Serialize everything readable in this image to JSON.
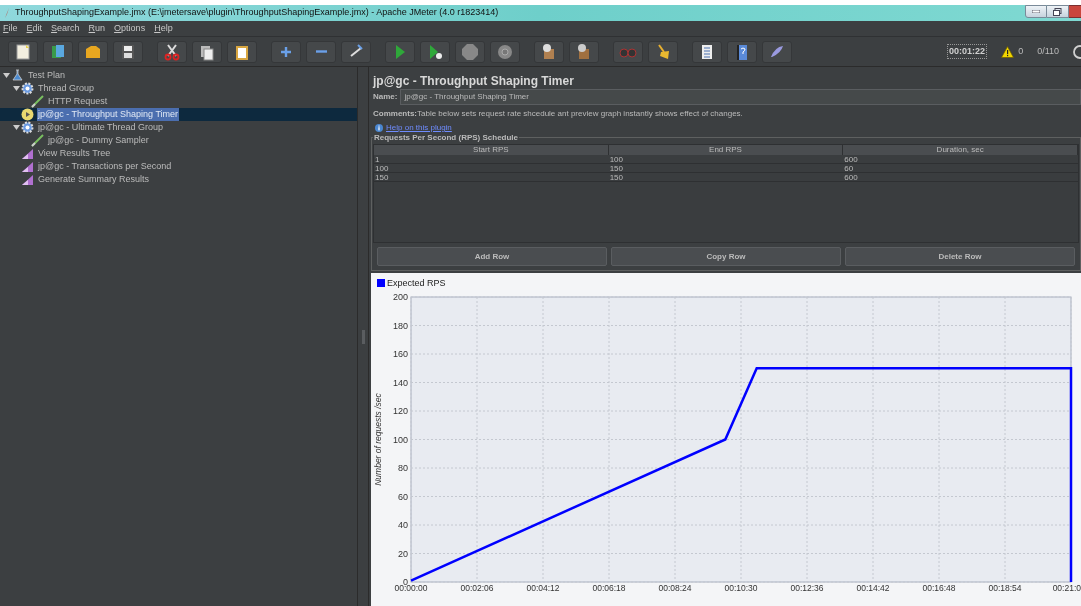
{
  "window": {
    "title": "ThroughputShapingExample.jmx (E:\\jmetersave\\plugin\\ThroughputShapingExample.jmx) - Apache JMeter (4.0 r1823414)"
  },
  "menu": [
    "File",
    "Edit",
    "Search",
    "Run",
    "Options",
    "Help"
  ],
  "status": {
    "timer": "00:01:22",
    "warnings": "0",
    "threads": "0/110"
  },
  "tree": [
    {
      "label": "Test Plan",
      "kind": "plan",
      "expanded": true,
      "selected": false,
      "children": [
        {
          "label": "Thread Group",
          "kind": "thread-group",
          "expanded": true,
          "selected": false,
          "children": [
            {
              "label": "HTTP Request",
              "kind": "sampler",
              "selected": false
            }
          ]
        },
        {
          "label": "jp@gc - Throughput Shaping Timer",
          "kind": "timer",
          "selected": true
        },
        {
          "label": "jp@gc - Ultimate Thread Group",
          "kind": "thread-group",
          "expanded": true,
          "selected": false,
          "children": [
            {
              "label": "jp@gc - Dummy Sampler",
              "kind": "sampler",
              "selected": false
            }
          ]
        },
        {
          "label": "View Results Tree",
          "kind": "listener",
          "selected": false
        },
        {
          "label": "jp@gc - Transactions per Second",
          "kind": "listener",
          "selected": false
        },
        {
          "label": "Generate Summary Results",
          "kind": "listener",
          "selected": false
        }
      ]
    }
  ],
  "editor": {
    "title": "jp@gc - Throughput Shaping Timer",
    "name_label": "Name:",
    "name_value": "jp@gc - Throughput Shaping Timer",
    "comments_label": "Comments:",
    "comments_text": "Table below sets request rate shcedule ant preview graph instantly shows effect of changes.",
    "help_link": "Help on this plugin",
    "schedule": {
      "legend": "Requests Per Second (RPS) Schedule",
      "columns": [
        "Start RPS",
        "End RPS",
        "Duration, sec"
      ],
      "rows": [
        [
          "1",
          "100",
          "600"
        ],
        [
          "100",
          "150",
          "60"
        ],
        [
          "150",
          "150",
          "600"
        ]
      ]
    },
    "buttons": [
      "Add Row",
      "Copy Row",
      "Delete Row"
    ],
    "chart_data": {
      "type": "line",
      "grid": true,
      "ylabel": "Number of requests /sec",
      "x": [
        0,
        600,
        660,
        1260,
        1260
      ],
      "series": [
        {
          "name": "Expected RPS",
          "color": "#0000ff",
          "values": [
            1,
            100,
            150,
            150,
            0
          ]
        }
      ],
      "xlim": [
        0,
        1260
      ],
      "ylim": [
        0,
        200
      ],
      "xticks": [
        {
          "value": 0,
          "label": "00:00:00"
        },
        {
          "value": 126,
          "label": "00:02:06"
        },
        {
          "value": 252,
          "label": "00:04:12"
        },
        {
          "value": 378,
          "label": "00:06:18"
        },
        {
          "value": 504,
          "label": "00:08:24"
        },
        {
          "value": 630,
          "label": "00:10:30"
        },
        {
          "value": 756,
          "label": "00:12:36"
        },
        {
          "value": 882,
          "label": "00:14:42"
        },
        {
          "value": 1008,
          "label": "00:16:48"
        },
        {
          "value": 1134,
          "label": "00:18:54"
        },
        {
          "value": 1260,
          "label": "00:21:0"
        }
      ],
      "yticks": [
        0,
        20,
        40,
        60,
        80,
        100,
        120,
        140,
        160,
        180,
        200
      ]
    }
  }
}
